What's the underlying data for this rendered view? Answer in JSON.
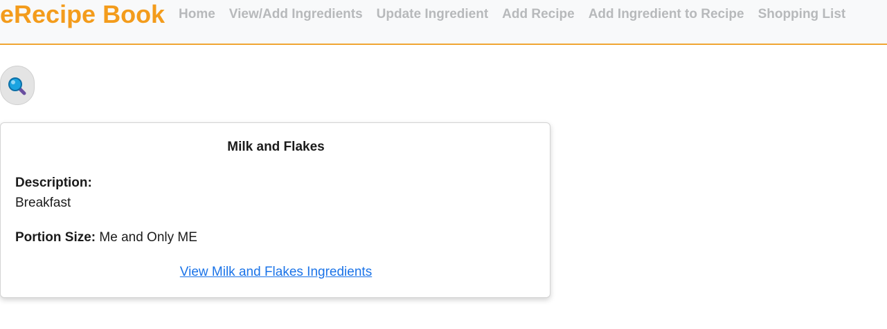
{
  "brand": {
    "name": "eRecipe Book",
    "color": "#f39c1c"
  },
  "nav": {
    "items": [
      {
        "label": "Home"
      },
      {
        "label": "View/Add Ingredients"
      },
      {
        "label": "Update Ingredient"
      },
      {
        "label": "Add Recipe"
      },
      {
        "label": "Add Ingredient to Recipe"
      },
      {
        "label": "Shopping List"
      }
    ]
  },
  "search": {
    "icon": "magnifying-glass-icon"
  },
  "recipe_card": {
    "title": "Milk and Flakes",
    "description_label": "Description:",
    "description": "Breakfast",
    "portion_label": "Portion Size:",
    "portion_value": "Me and Only ME",
    "ingredients_link": "View Milk and Flakes Ingredients"
  },
  "colors": {
    "accent": "#f0a531",
    "nav_text": "#b7b9bb",
    "link": "#1a73e8"
  }
}
